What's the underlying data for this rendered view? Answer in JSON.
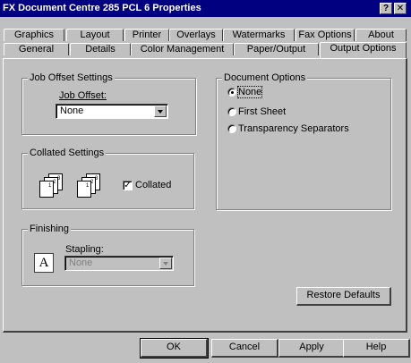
{
  "window": {
    "title": "FX Document Centre 285 PCL 6 Properties",
    "help_button": "?",
    "close_button": "✕"
  },
  "tabs": {
    "back_row": [
      "Graphics",
      "Layout",
      "Printer",
      "Overlays",
      "Watermarks",
      "Fax Options",
      "About"
    ],
    "front_row": [
      "General",
      "Details",
      "Color Management",
      "Paper/Output",
      "Output Options"
    ],
    "active": "Output Options"
  },
  "job_offset": {
    "group_label": "Job Offset Settings",
    "field_label": "Job Offset:",
    "value": "None"
  },
  "collated": {
    "group_label": "Collated Settings",
    "checkbox_label": "Collated",
    "checked": true
  },
  "finishing": {
    "group_label": "Finishing",
    "stapling_label": "Stapling:",
    "stapling_value": "None",
    "icon_letter": "A"
  },
  "document_options": {
    "group_label": "Document Options",
    "options": [
      "None",
      "First Sheet",
      "Transparency Separators"
    ],
    "selected": "None"
  },
  "restore_defaults_label": "Restore Defaults",
  "buttons": {
    "ok": "OK",
    "cancel": "Cancel",
    "apply": "Apply",
    "help": "Help"
  }
}
